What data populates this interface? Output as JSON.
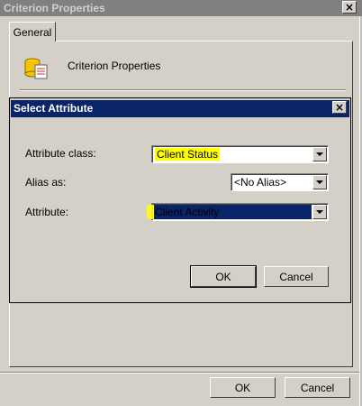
{
  "window": {
    "title": "Criterion Properties",
    "tab_general": "General",
    "header_label": "Criterion Properties",
    "ok_label": "OK",
    "cancel_label": "Cancel",
    "close_glyph": "×"
  },
  "dialog": {
    "title": "Select Attribute",
    "close_glyph": "×",
    "attribute_class_label": "Attribute class:",
    "attribute_class_value": "Client Status",
    "alias_label": "Alias as:",
    "alias_value": "<No Alias>",
    "attribute_label": "Attribute:",
    "attribute_value": "Client Activity",
    "ok_label": "OK",
    "cancel_label": "Cancel"
  },
  "colors": {
    "highlight": "#ffff00",
    "title_bar_active": "#0a246a",
    "title_bar_inactive": "#808080",
    "face": "#d4d0c8"
  },
  "icons": {
    "header": "database-properties-icon",
    "close": "close-icon",
    "dropdown": "chevron-down-icon"
  }
}
